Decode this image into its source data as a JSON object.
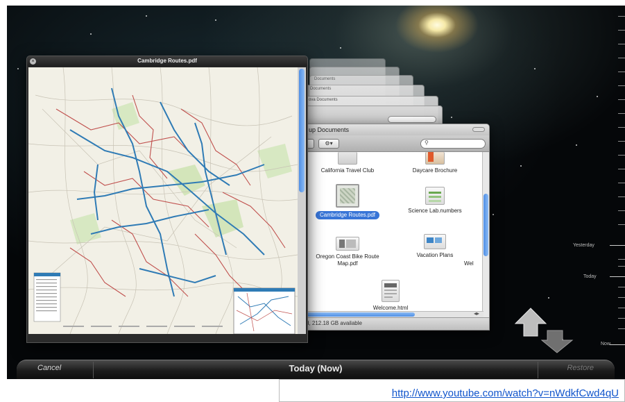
{
  "preview": {
    "title": "Cambridge Routes.pdf"
  },
  "finder": {
    "title": "up Documents",
    "stack_titles": [
      "Documents",
      "Documents",
      "ova Documents"
    ],
    "search_icon": "search-icon",
    "files": [
      {
        "label": "California Travel Club",
        "selected": false
      },
      {
        "label": "Daycare Brochure",
        "selected": false
      },
      {
        "label": "Cambridge Routes.pdf",
        "selected": true
      },
      {
        "label": "Science Lab.numbers",
        "selected": false
      },
      {
        "label": "Oregon Coast Bike Route Map.pdf",
        "selected": false
      },
      {
        "label": "Vacation Plans",
        "selected": false
      },
      {
        "label": "Wel",
        "selected": false
      },
      {
        "label": "Welcome.html",
        "selected": false
      }
    ],
    "status": "d, 212.18 GB available"
  },
  "timeline": {
    "labels": [
      "Yesterday",
      "Today",
      "Now"
    ]
  },
  "timemachine": {
    "cancel_label": "Cancel",
    "current_label": "Today (Now)",
    "restore_label": "Restore"
  },
  "footer": {
    "url": "http://www.youtube.com/watch?v=nWdkfCwd4qU"
  },
  "colors": {
    "selection": "#3875d7",
    "scroll_thumb": "#4f8fe6",
    "map_route_blue": "#2f7bb5",
    "map_route_red": "#c0504d",
    "link": "#1155cc"
  }
}
